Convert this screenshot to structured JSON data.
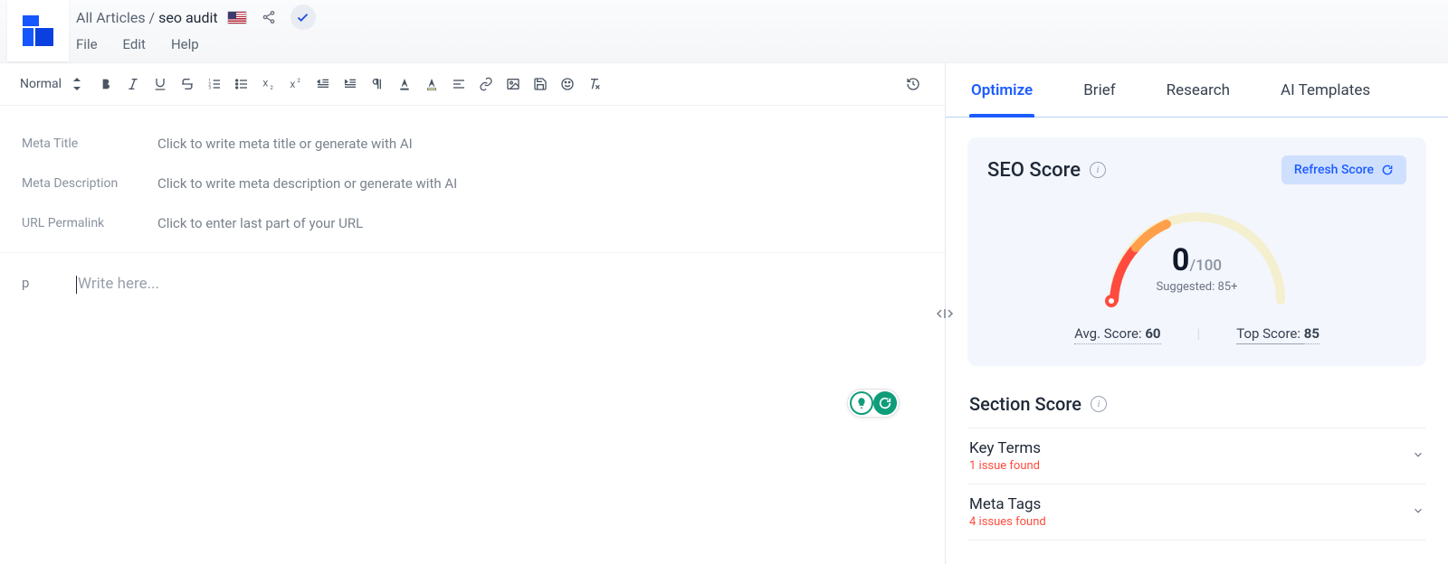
{
  "breadcrumb": {
    "root": "All Articles",
    "sep": "/",
    "current": "seo audit"
  },
  "menu": {
    "file": "File",
    "edit": "Edit",
    "help": "Help"
  },
  "toolbar": {
    "style_label": "Normal"
  },
  "meta": {
    "title_label": "Meta Title",
    "title_placeholder": "Click to write meta title or generate with AI",
    "desc_label": "Meta Description",
    "desc_placeholder": "Click to write meta description or generate with AI",
    "url_label": "URL Permalink",
    "url_placeholder": "Click to enter last part of your URL"
  },
  "body": {
    "tag": "p",
    "placeholder": "Write here..."
  },
  "side": {
    "tabs": {
      "optimize": "Optimize",
      "brief": "Brief",
      "research": "Research",
      "ai": "AI Templates"
    },
    "score": {
      "title": "SEO Score",
      "refresh": "Refresh Score",
      "value": "0",
      "max": "/100",
      "suggested": "Suggested: 85+",
      "avg_label": "Avg. Score: ",
      "avg_value": "60",
      "top_label": "Top Score: ",
      "top_value": "85"
    },
    "section": {
      "title": "Section Score",
      "items": [
        {
          "name": "Key Terms",
          "issue": "1 issue found"
        },
        {
          "name": "Meta Tags",
          "issue": "4 issues found"
        }
      ]
    }
  }
}
